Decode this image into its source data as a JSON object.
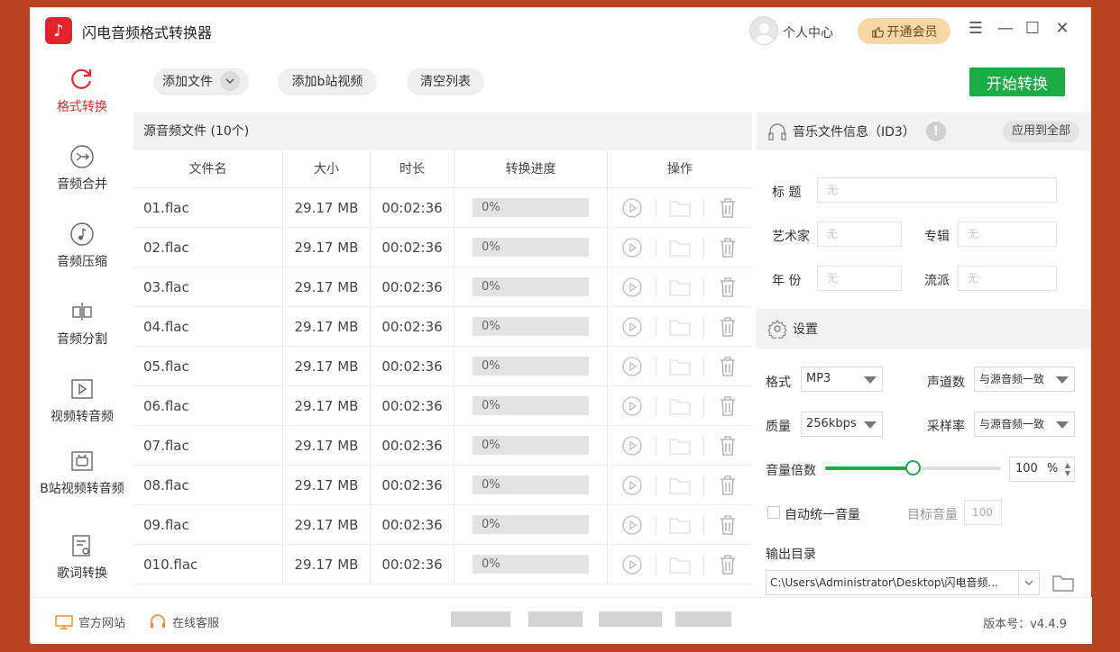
{
  "app": {
    "title": "闪电音频格式转换器",
    "logo_glyph": "♪"
  },
  "header": {
    "user_center": "个人中心",
    "vip_button": "开通会员",
    "vip_icon": "thumb-up-icon"
  },
  "sidebar": {
    "items": [
      {
        "label": "格式转换",
        "icon": "refresh-icon",
        "active": true
      },
      {
        "label": "音频合并",
        "icon": "merge-icon"
      },
      {
        "label": "音频压缩",
        "icon": "music-note-icon"
      },
      {
        "label": "音频分割",
        "icon": "split-icon"
      },
      {
        "label": "视频转音频",
        "icon": "video-play-icon"
      },
      {
        "label": "B站视频转音频",
        "icon": "bilibili-tv-icon"
      },
      {
        "label": "歌词转换",
        "icon": "lyrics-doc-icon"
      }
    ]
  },
  "toolbar": {
    "add_file": "添加文件",
    "add_bili": "添加b站视频",
    "clear_list": "清空列表",
    "start": "开始转换"
  },
  "table": {
    "caption": "源音频文件 (10个)",
    "headers": [
      "文件名",
      "大小",
      "时长",
      "转换进度",
      "操作"
    ],
    "rows": [
      {
        "name": "01.flac",
        "size": "29.17 MB",
        "duration": "00:02:36",
        "progress": "0%"
      },
      {
        "name": "02.flac",
        "size": "29.17 MB",
        "duration": "00:02:36",
        "progress": "0%"
      },
      {
        "name": "03.flac",
        "size": "29.17 MB",
        "duration": "00:02:36",
        "progress": "0%"
      },
      {
        "name": "04.flac",
        "size": "29.17 MB",
        "duration": "00:02:36",
        "progress": "0%"
      },
      {
        "name": "05.flac",
        "size": "29.17 MB",
        "duration": "00:02:36",
        "progress": "0%"
      },
      {
        "name": "06.flac",
        "size": "29.17 MB",
        "duration": "00:02:36",
        "progress": "0%"
      },
      {
        "name": "07.flac",
        "size": "29.17 MB",
        "duration": "00:02:36",
        "progress": "0%"
      },
      {
        "name": "08.flac",
        "size": "29.17 MB",
        "duration": "00:02:36",
        "progress": "0%"
      },
      {
        "name": "09.flac",
        "size": "29.17 MB",
        "duration": "00:02:36",
        "progress": "0%"
      },
      {
        "name": "010.flac",
        "size": "29.17 MB",
        "duration": "00:02:36",
        "progress": "0%"
      }
    ]
  },
  "id3": {
    "title": "音乐文件信息（ID3）",
    "apply_all": "应用到全部",
    "title_label": "标  题",
    "title_value": "无",
    "artist_label": "艺术家",
    "artist_value": "无",
    "album_label": "专辑",
    "album_value": "无",
    "year_label": "年  份",
    "year_value": "无",
    "genre_label": "流派",
    "genre_value": "无"
  },
  "settings": {
    "title": "设置",
    "format_label": "格式",
    "format_value": "MP3",
    "channels_label": "声道数",
    "channels_value": "与源音频一致",
    "quality_label": "质量",
    "quality_value": "256kbps",
    "samplerate_label": "采样率",
    "samplerate_value": "与源音频一致",
    "volume_label": "音量倍数",
    "volume_value": "100",
    "volume_unit": "%",
    "volume_level": 0.5,
    "auto_volume_label": "自动统一音量",
    "target_volume_label": "目标音量",
    "target_volume_value": "100",
    "output_label": "输出目录",
    "output_path": "C:\\Users\\Administrator\\Desktop\\闪电音频..."
  },
  "footer": {
    "website": "官方网站",
    "support": "在线客服",
    "version": "版本号：v4.4.9"
  },
  "colors": {
    "accent_green": "#1aac45",
    "active_red": "#e02c2c",
    "background": "#b94422"
  }
}
